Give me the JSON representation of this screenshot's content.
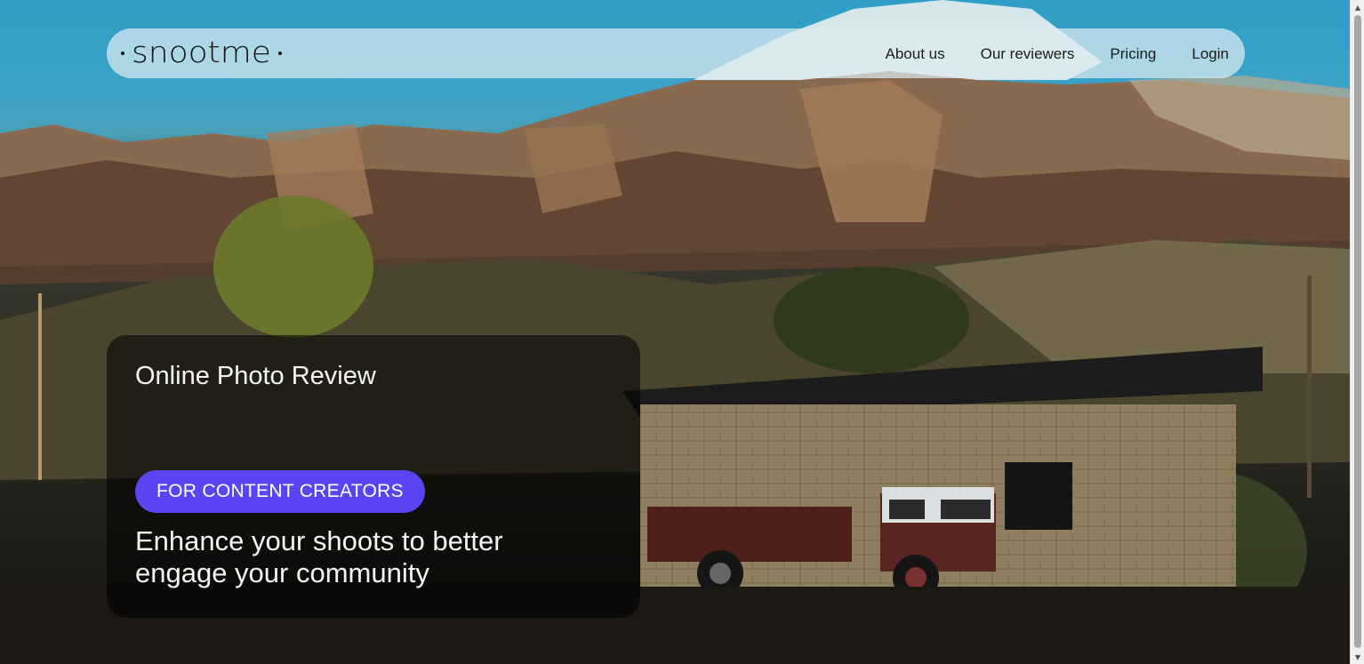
{
  "brand": {
    "logo_text": "snootme"
  },
  "nav": {
    "links": [
      "About us",
      "Our reviewers",
      "Pricing",
      "Login"
    ]
  },
  "hero": {
    "title": "Online Photo Review",
    "badge_label": "FOR CONTENT CREATORS",
    "tagline": "Enhance your shoots to better engage your community"
  },
  "colors": {
    "accent": "#5b45f2",
    "navbar_bg": "#dcecf2",
    "card_bg": "#000000"
  }
}
